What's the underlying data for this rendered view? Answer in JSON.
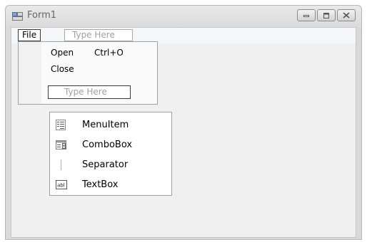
{
  "window": {
    "title": "Form1"
  },
  "menubar": {
    "file_label": "File",
    "type_here": "Type Here"
  },
  "file_menu": {
    "items": [
      {
        "label": "Open",
        "shortcut": "Ctrl+O"
      },
      {
        "label": "Close"
      }
    ],
    "type_here": "Type Here"
  },
  "type_menu": {
    "items": [
      {
        "label": "MenuItem",
        "icon": "menu-item-icon"
      },
      {
        "label": "ComboBox",
        "icon": "combobox-icon"
      },
      {
        "label": "Separator",
        "icon": "separator-icon"
      },
      {
        "label": "TextBox",
        "icon": "textbox-icon"
      }
    ]
  }
}
